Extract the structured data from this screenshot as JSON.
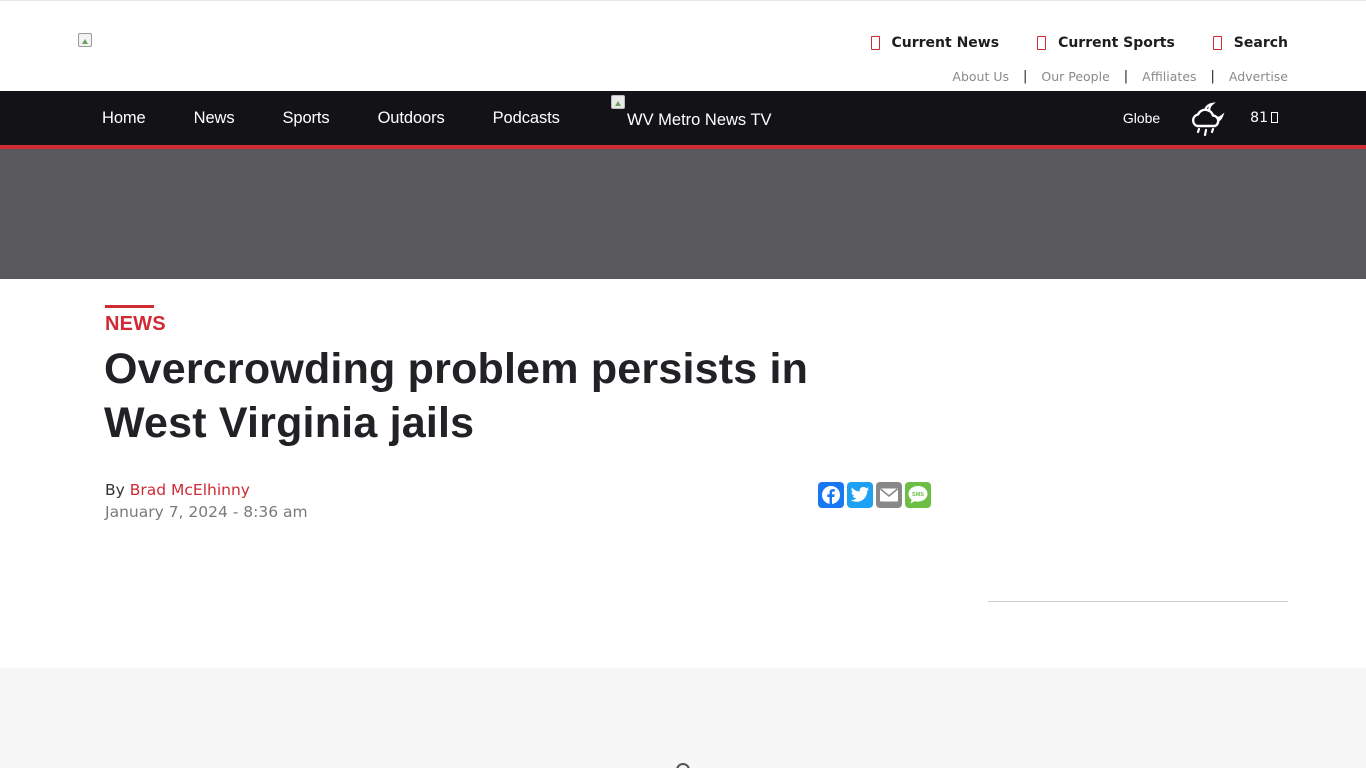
{
  "header": {
    "logo_icon": "broken-image-icon",
    "quick_links": [
      {
        "label": "Current News",
        "icon": "missing-glyph-icon"
      },
      {
        "label": "Current Sports",
        "icon": "missing-glyph-icon"
      },
      {
        "label": "Search",
        "icon": "missing-glyph-icon"
      }
    ],
    "secondary_links": [
      "About Us",
      "Our People",
      "Affiliates",
      "Advertise"
    ],
    "separator": "|"
  },
  "nav": {
    "items": [
      "Home",
      "News",
      "Sports",
      "Outdoors",
      "Podcasts"
    ],
    "tv_alt": "WV Metro News TV",
    "weather": {
      "city": "Globe",
      "icon": "cloud-rain-night-icon",
      "temperature": "81"
    }
  },
  "article": {
    "category": "NEWS",
    "title": "Overcrowding problem persists in West Virginia jails",
    "byline_prefix": "By",
    "author": "Brad McElhinny",
    "date": "January 7, 2024 - 8:36 am",
    "share": [
      "Facebook",
      "Twitter",
      "Email",
      "SMS"
    ]
  },
  "colors": {
    "accent": "#d02a33",
    "nav_bg": "#131317",
    "ad_band": "#58585d",
    "facebook": "#1877f2",
    "twitter": "#1da1f2",
    "email": "#888888",
    "sms": "#6cbe45"
  }
}
